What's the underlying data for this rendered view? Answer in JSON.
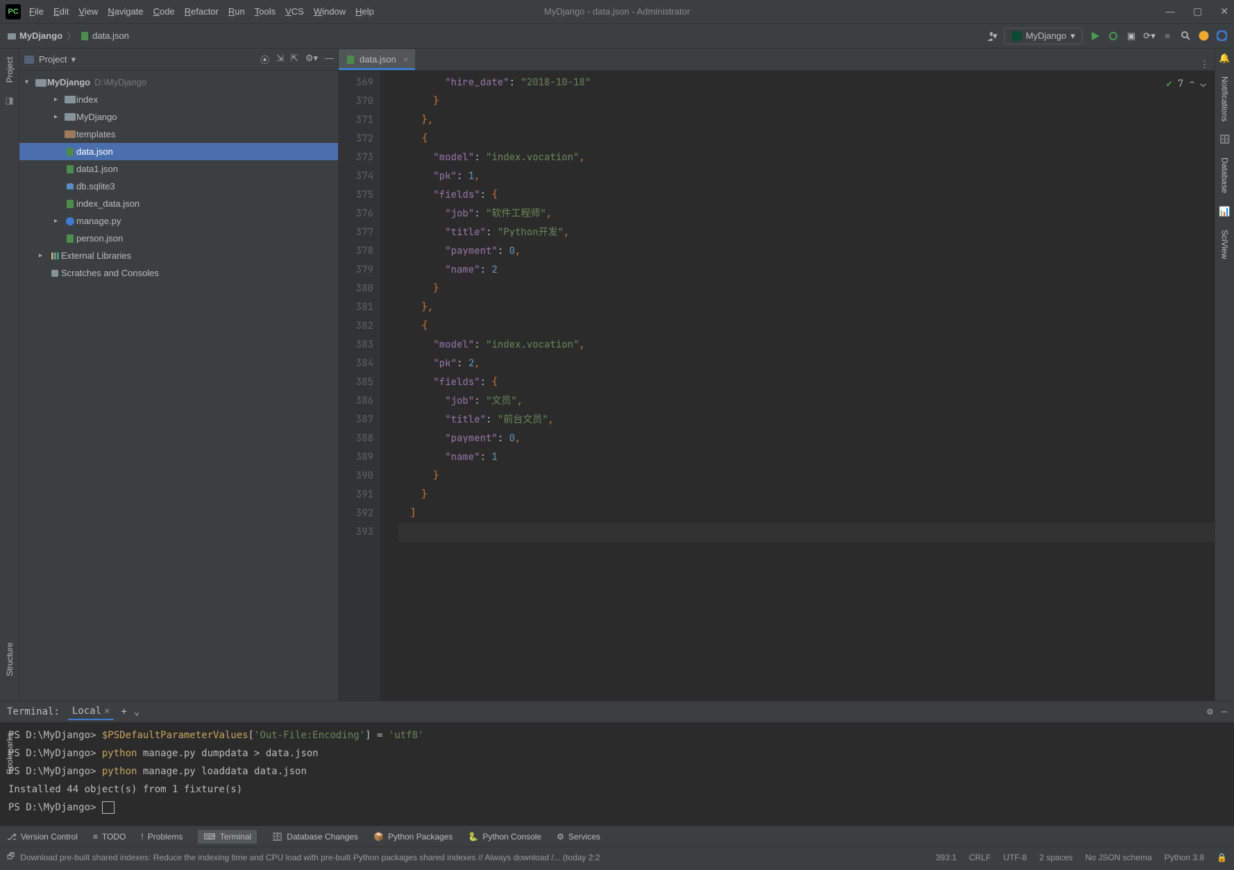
{
  "title": "MyDjango - data.json - Administrator",
  "menu": [
    "File",
    "Edit",
    "View",
    "Navigate",
    "Code",
    "Refactor",
    "Run",
    "Tools",
    "VCS",
    "Window",
    "Help"
  ],
  "breadcrumb": {
    "root": "MyDjango",
    "file": "data.json"
  },
  "runConfig": "MyDjango",
  "projectHeader": "Project",
  "tree": {
    "root": {
      "name": "MyDjango",
      "path": "D:\\MyDjango"
    },
    "items": [
      {
        "name": "index",
        "depth": 1,
        "tw": ">",
        "kind": "djfolder"
      },
      {
        "name": "MyDjango",
        "depth": 1,
        "tw": ">",
        "kind": "djfolder"
      },
      {
        "name": "templates",
        "depth": 1,
        "tw": "",
        "kind": "folder"
      },
      {
        "name": "data.json",
        "depth": 1,
        "tw": "",
        "kind": "file",
        "sel": true
      },
      {
        "name": "data1.json",
        "depth": 1,
        "tw": "",
        "kind": "file"
      },
      {
        "name": "db.sqlite3",
        "depth": 1,
        "tw": "",
        "kind": "db"
      },
      {
        "name": "index_data.json",
        "depth": 1,
        "tw": "",
        "kind": "file"
      },
      {
        "name": "manage.py",
        "depth": 1,
        "tw": ">",
        "kind": "py"
      },
      {
        "name": "person.json",
        "depth": 1,
        "tw": "",
        "kind": "file"
      },
      {
        "name": "External Libraries",
        "depth": 0,
        "tw": ">",
        "kind": "lib"
      },
      {
        "name": "Scratches and Consoles",
        "depth": 0,
        "tw": "",
        "kind": "scratch"
      }
    ]
  },
  "tab": {
    "name": "data.json"
  },
  "inspection": {
    "count": "7"
  },
  "code": {
    "startLine": 369,
    "lines": [
      "        \"hire_date\": \"2018-10-18\"",
      "      }",
      "    },",
      "    {",
      "      \"model\": \"index.vocation\",",
      "      \"pk\": 1,",
      "      \"fields\": {",
      "        \"job\": \"软件工程师\",",
      "        \"title\": \"Python开发\",",
      "        \"payment\": 0,",
      "        \"name\": 2",
      "      }",
      "    },",
      "    {",
      "      \"model\": \"index.vocation\",",
      "      \"pk\": 2,",
      "      \"fields\": {",
      "        \"job\": \"文员\",",
      "        \"title\": \"前台文员\",",
      "        \"payment\": 0,",
      "        \"name\": 1",
      "      }",
      "    }",
      "  ]",
      ""
    ]
  },
  "terminal": {
    "label": "Terminal:",
    "tab": "Local",
    "lines": [
      {
        "prompt": "PS D:\\MyDjango> ",
        "cmd": "$PSDefaultParameterValues",
        "tail": "['Out-File:Encoding'] = 'utf8'"
      },
      {
        "prompt": "PS D:\\MyDjango> ",
        "cmd": "python",
        "tail": " manage.py dumpdata > data.json"
      },
      {
        "prompt": "PS D:\\MyDjango> ",
        "cmd": "python",
        "tail": " manage.py loaddata data.json"
      },
      {
        "plain": "Installed 44 object(s) from 1 fixture(s)"
      },
      {
        "prompt": "PS D:\\MyDjango> ",
        "cursor": true
      }
    ]
  },
  "toolButtons": [
    "Version Control",
    "TODO",
    "Problems",
    "Terminal",
    "Database Changes",
    "Python Packages",
    "Python Console",
    "Services"
  ],
  "status": {
    "msg": "Download pre-built shared indexes: Reduce the indexing time and CPU load with pre-built Python packages shared indexes // Always download /... (today 2:2",
    "pos": "393:1",
    "eol": "CRLF",
    "enc": "UTF-8",
    "indent": "2 spaces",
    "schema": "No JSON schema",
    "py": "Python 3.8"
  },
  "rightTabs": [
    "Notifications",
    "Database",
    "SciView"
  ],
  "leftTabs": [
    "Project",
    "Structure",
    "Bookmarks"
  ]
}
